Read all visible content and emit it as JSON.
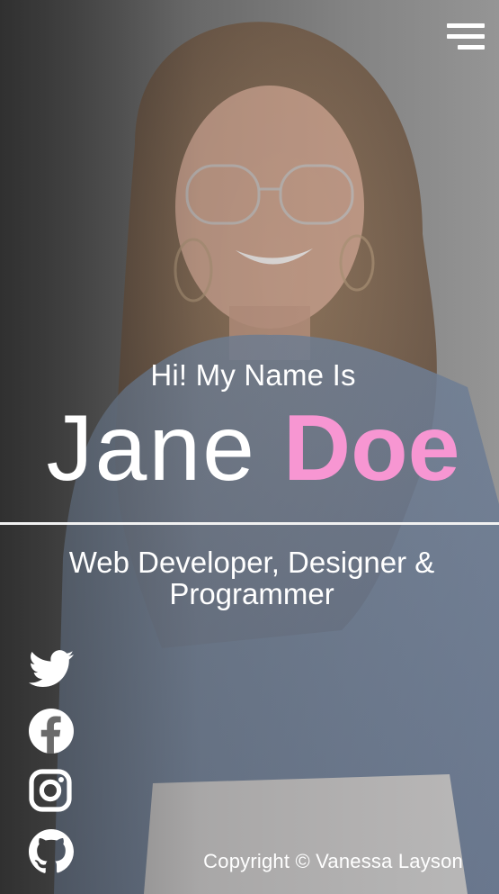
{
  "hero": {
    "greeting": "Hi! My Name Is",
    "first_name": "Jane",
    "last_name": "Doe",
    "role_line1": "Web Developer, Designer &",
    "role_line2": "Programmer"
  },
  "colors": {
    "accent": "#f796d2",
    "text": "#ffffff"
  },
  "social": {
    "icons": [
      "twitter-icon",
      "facebook-icon",
      "instagram-icon",
      "github-icon"
    ]
  },
  "footer": {
    "copyright": "Copyright © Vanessa Layson"
  }
}
